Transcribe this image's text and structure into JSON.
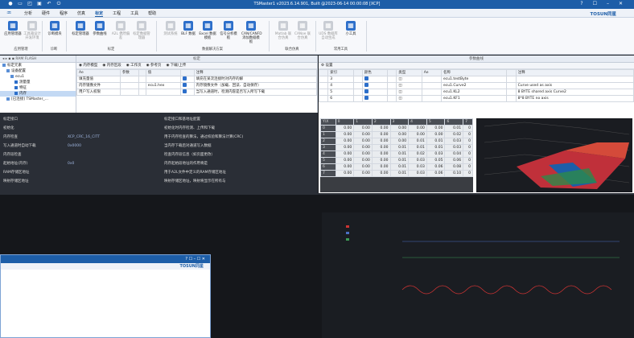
{
  "titlebar": {
    "title": "TSMaster1 v2023.6.14.901, Built @2023-06-14 00:00:08 [XCP]",
    "minimize": "–",
    "maximize": "☐",
    "close": "✕",
    "help": "?"
  },
  "menu": {
    "items": [
      "分析",
      "硬件",
      "程序",
      "仿真",
      "标定",
      "工程",
      "工具",
      "帮助"
    ],
    "active_index": 4,
    "brand": "TOSUN同星"
  },
  "ribbon": {
    "buttons": [
      {
        "label": "应用管理器",
        "icon": "app-manager-icon",
        "color": "#2d6fca",
        "enabled": true
      },
      {
        "label": "工具箱设计开发环境",
        "icon": "toolbox-icon",
        "color": "#c9cdd4",
        "enabled": false
      },
      {
        "label": "诊断模块",
        "icon": "diagnostic-icon",
        "color": "#2d6fca",
        "enabled": true
      },
      {
        "label": "标定管理器",
        "icon": "calibration-manager-icon",
        "color": "#2d6fca",
        "enabled": true
      },
      {
        "label": "参数曲线",
        "icon": "curve-icon",
        "color": "#2d6fca",
        "enabled": true
      },
      {
        "label": "A2L 偶然偏差",
        "icon": "a2l-icon",
        "color": "#c9cdd4",
        "enabled": false
      },
      {
        "label": "标定数据管理器",
        "icon": "data-manager-icon",
        "color": "#c9cdd4",
        "enabled": false
      },
      {
        "label": "测试系统",
        "icon": "test-system-icon",
        "color": "#c9cdd4",
        "enabled": false
      },
      {
        "label": "BLF 数据",
        "icon": "blf-icon",
        "color": "#2d6fca",
        "enabled": true
      },
      {
        "label": "Excel 数据模板",
        "icon": "excel-icon",
        "color": "#2d6fca",
        "enabled": true
      },
      {
        "label": "信号分析模板",
        "icon": "signal-icon",
        "color": "#2d6fca",
        "enabled": true
      },
      {
        "label": "CAN/CANFD 添加数据模板",
        "icon": "canfd-icon",
        "color": "#2d6fca",
        "enabled": true
      },
      {
        "label": "Matlab 联合仿真",
        "icon": "matlab-icon",
        "color": "#c9cdd4",
        "enabled": false
      },
      {
        "label": "CANoe 联合仿真",
        "icon": "canoe-icon",
        "color": "#c9cdd4",
        "enabled": false
      },
      {
        "label": "UDS 数据库自动生成",
        "icon": "uds-icon",
        "color": "#c9cdd4",
        "enabled": false
      },
      {
        "label": "小工具",
        "icon": "wrench-icon",
        "color": "#2d6fca",
        "enabled": true
      }
    ],
    "groups": [
      "应用管理",
      "诊断",
      "标定",
      "数据解决方案",
      "联合仿真",
      "常用工具"
    ]
  },
  "left_panel": {
    "header": "",
    "toolbar": "RAM    FLASH",
    "tree": [
      {
        "label": "标定元素",
        "level": 0,
        "selected": false
      },
      {
        "label": "设备配置",
        "level": 1,
        "selected": false
      },
      {
        "label": "ecu1",
        "level": 2,
        "selected": false
      },
      {
        "label": "测量量",
        "level": 3,
        "selected": false
      },
      {
        "label": "特征",
        "level": 3,
        "selected": false
      },
      {
        "label": "内存",
        "level": 3,
        "selected": true
      },
      {
        "label": "[已连接] TSMaster_...",
        "level": 1,
        "selected": false
      }
    ]
  },
  "center_panel": {
    "header": "标定",
    "tabs": [
      "内存模型",
      "内存区段",
      "工作页",
      "参考页",
      "下载/上传"
    ],
    "columns": [
      "Ae",
      "参数",
      "",
      "值",
      "",
      "注释"
    ],
    "rows": [
      {
        "param": "填充量值",
        "value": "",
        "note": "填充在某次连接时对内存的解"
      },
      {
        "param": "内存镜像文件",
        "value": "ecu1.hex",
        "note": "内存镜像文件（加载、回读、自动保存）"
      },
      {
        "param": "用户写入权限",
        "value": "",
        "note": "当写入通道时，检测内容是否写入所写下载"
      }
    ]
  },
  "dark_rows": [
    {
      "label": "标定接口",
      "value": "",
      "note": "标定接口和基地址配置"
    },
    {
      "label": "初始化",
      "value": "",
      "note": "初始化时内存检测、上传和下载"
    },
    {
      "label": "内存检查",
      "value": "XCP_CRC_16_CITT",
      "note": "用于内存检查的算法，通过校验和算法计算(CRC)"
    },
    {
      "label": "写入通道时自动下载",
      "value": "0x0000",
      "note": "当内存下载后对通道写入数据"
    },
    {
      "label": "内存段检查",
      "value": "",
      "note": "检查内存段信息（如页面更改）"
    },
    {
      "label": "起始地址(内存)",
      "value": "0x0",
      "note": "内存起始段地址的作用将是"
    },
    {
      "label": "RAM存储区地址",
      "value": "",
      "note": "用于A2L文件中定义的RAM存储区地址"
    },
    {
      "label": "映射存储区地址",
      "value": "",
      "note": "映射存储区地址，映射将显示在所有与"
    }
  ],
  "right_panel": {
    "header": "参数曲线",
    "toolbar": "设置",
    "columns": [
      "",
      "索引",
      "",
      "颜色",
      "",
      "类型",
      "Ae",
      "名称",
      "",
      "注释"
    ],
    "rows": [
      {
        "index": "3",
        "name": "ecu1.testByte",
        "note": ""
      },
      {
        "index": "4",
        "name": "ecu1.Curve2",
        "note": "Curve used as axis"
      },
      {
        "index": "5",
        "name": "ecu1.KL2",
        "note": "8 BYTE shared axis Curve2"
      },
      {
        "index": "6",
        "name": "ecu1.KF1",
        "note": "8*8 BYTE no axis"
      }
    ],
    "heatmap_axis_label": "Y\\X",
    "heatmap_col_headers": [
      "0",
      "1",
      "2",
      "3",
      "4",
      "5",
      "6",
      "7"
    ],
    "heatmap_values": [
      [
        "0.00",
        "0.00",
        "0.00",
        "0.00",
        "0.00",
        "0.00",
        "0.01",
        "0"
      ],
      [
        "0.00",
        "0.00",
        "0.00",
        "0.00",
        "0.00",
        "0.00",
        "0.02",
        "0"
      ],
      [
        "0.00",
        "0.00",
        "0.00",
        "0.00",
        "0.01",
        "0.01",
        "0.03",
        "0"
      ],
      [
        "0.00",
        "0.00",
        "0.00",
        "0.01",
        "0.01",
        "0.01",
        "0.03",
        "0"
      ],
      [
        "0.00",
        "0.00",
        "0.00",
        "0.01",
        "0.02",
        "0.03",
        "0.04",
        "0"
      ],
      [
        "0.00",
        "0.00",
        "0.00",
        "0.01",
        "0.03",
        "0.05",
        "0.06",
        "0"
      ],
      [
        "0.00",
        "0.00",
        "0.00",
        "0.01",
        "0.03",
        "0.06",
        "0.08",
        "0"
      ],
      [
        "0.00",
        "0.00",
        "0.00",
        "0.01",
        "0.03",
        "0.06",
        "0.10",
        "0"
      ]
    ]
  },
  "second_window": {
    "brand": "TOSUN同星",
    "controls": "? ☐ – ☐ ✕"
  }
}
